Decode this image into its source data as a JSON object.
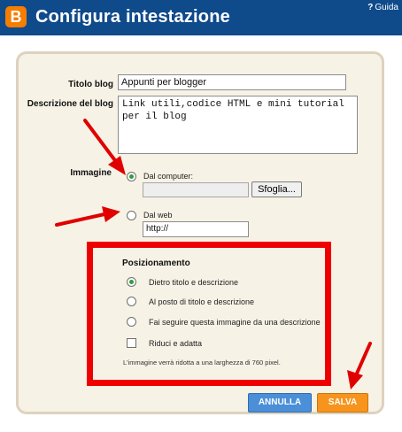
{
  "header": {
    "title": "Configura intestazione",
    "help_label": "Guida",
    "help_icon": "?"
  },
  "form": {
    "blog_title_label": "Titolo blog",
    "blog_title_value": "Appunti per blogger",
    "blog_desc_label": "Descrizione del blog",
    "blog_desc_value": "Link utili,codice HTML e mini tutorial\nper il blog",
    "image_label": "Immagine",
    "from_computer_label": "Dal computer:",
    "browse_label": "Sfoglia...",
    "from_web_label": "Dal web",
    "url_value": "http://"
  },
  "positioning": {
    "title": "Posizionamento",
    "options": [
      {
        "label": "Dietro titolo e descrizione",
        "selected": true
      },
      {
        "label": "Al posto di titolo e descrizione",
        "selected": false
      },
      {
        "label": "Fai seguire questa immagine da una descrizione",
        "selected": false
      }
    ],
    "shrink_label": "Riduci e adatta",
    "shrink_checked": false,
    "note": "L'immagine verrà ridotta a una larghezza di 760 pixel."
  },
  "buttons": {
    "cancel": "ANNULLA",
    "save": "SALVA"
  },
  "colors": {
    "header_bg": "#0f4a8b",
    "panel_bg": "#f7f2e6",
    "highlight": "#ee0000",
    "cancel_bg": "#4a8fd8",
    "save_bg": "#f7941d"
  }
}
